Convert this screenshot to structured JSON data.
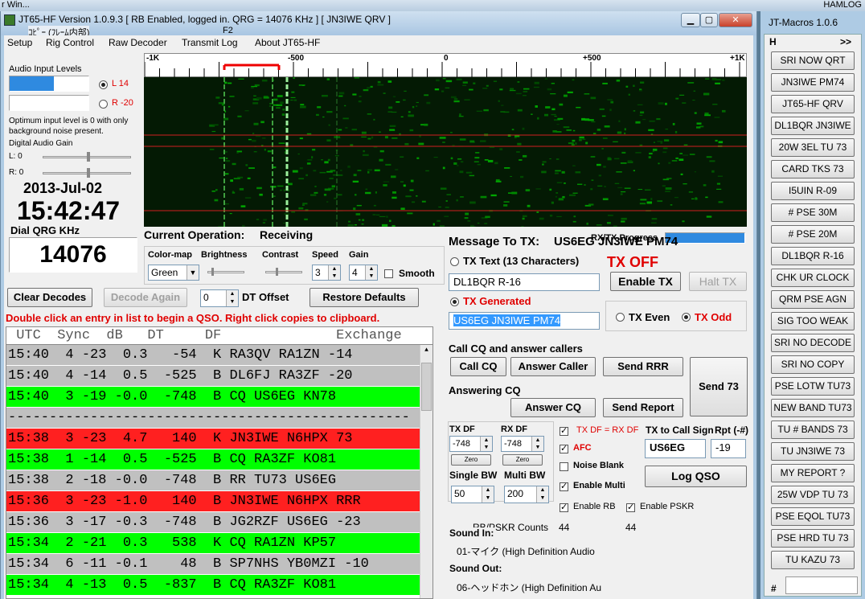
{
  "desktop": {
    "left_text": "r Win...",
    "right_text": "HAMLOG"
  },
  "title": {
    "text": "JT65-HF Version 1.0.9.3  [ RB Enabled, logged in.  QRG = 14076 KHz ] [ JN3IWE QRV ]",
    "overlay": "ｺﾋﾟｰ (ﾌﾚｰﾑ内部)",
    "overlay_key": "F2"
  },
  "menu": [
    "Setup",
    "Rig Control",
    "Raw Decoder",
    "Transmit Log",
    "About JT65-HF"
  ],
  "audio": {
    "label": "Audio Input Levels",
    "left": "L 14",
    "right": "R -20",
    "note": "Optimum input level is 0 with only background noise present.",
    "gain_label": "Digital Audio Gain",
    "gain_l": "L: 0",
    "gain_r": "R: 0",
    "left_level": 0.56
  },
  "clock": {
    "date": "2013-Jul-02",
    "time": "15:42:47",
    "qrg_label": "Dial QRG KHz",
    "qrg": "14076"
  },
  "waterfall": {
    "ticks": [
      "-1K",
      "-500",
      "0",
      "+500",
      "+1K"
    ]
  },
  "operation": {
    "label": "Current Operation:",
    "value": "Receiving"
  },
  "progress": {
    "label": "RX/TX Progress"
  },
  "controls": {
    "colormap_label": "Color-map",
    "colormap": "Green",
    "brightness_label": "Brightness",
    "contrast_label": "Contrast",
    "speed_label": "Speed",
    "speed": "3",
    "gain_label": "Gain",
    "gain": "4",
    "smooth": "Smooth"
  },
  "buttons": {
    "clear": "Clear Decodes",
    "decode_again": "Decode Again",
    "dt_offset": "0",
    "dt_label": "DT Offset",
    "restore": "Restore Defaults"
  },
  "hint": "Double click an entry in list to begin a QSO.  Right click copies to clipboard.",
  "decodes": {
    "header": " UTC  Sync  dB   DT     DF              Exchange",
    "rows": [
      {
        "t": "15:40  4 -23  0.3   -54  K RA3QV RA1ZN -14",
        "c": "#c0c0c0"
      },
      {
        "t": "15:40  4 -14  0.5  -525  B DL6FJ RA3ZF -20",
        "c": "#c0c0c0"
      },
      {
        "t": "15:40  3 -19 -0.0  -748  B CQ US6EG KN78",
        "c": "#00ff00"
      },
      {
        "t": "-------------------------------------------------",
        "c": "#c0c0c0"
      },
      {
        "t": "15:38  3 -23  4.7   140  K JN3IWE N6HPX 73",
        "c": "#ff2020"
      },
      {
        "t": "15:38  1 -14  0.5  -525  B CQ RA3ZF KO81",
        "c": "#00ff00"
      },
      {
        "t": "15:38  2 -18 -0.0  -748  B RR TU73 US6EG",
        "c": "#c0c0c0"
      },
      {
        "t": "15:36  3 -23 -1.0   140  B JN3IWE N6HPX RRR",
        "c": "#ff2020"
      },
      {
        "t": "15:36  3 -17 -0.3  -748  B JG2RZF US6EG -23",
        "c": "#c0c0c0"
      },
      {
        "t": "15:34  2 -21  0.3   538  K CQ RA1ZN KP57",
        "c": "#00ff00"
      },
      {
        "t": "15:34  6 -11 -0.1    48  B SP7NHS YB0MZI -10",
        "c": "#c0c0c0"
      },
      {
        "t": "15:34  4 -13  0.5  -837  B CQ RA3ZF KO81",
        "c": "#00ff00"
      }
    ]
  },
  "tx": {
    "msg_label": "Message To TX:",
    "msg": "US6EG JN3IWE PM74",
    "text_label": "TX Text (13 Characters)",
    "tx_state": "TX OFF",
    "text_value": "DL1BQR R-16",
    "enable": "Enable TX",
    "halt": "Halt TX",
    "gen_label": "TX Generated",
    "gen_value": "US6EG JN3IWE PM74",
    "even": "TX Even",
    "odd": "TX Odd"
  },
  "cq": {
    "label": "Call CQ and answer callers",
    "call": "Call CQ",
    "answer_caller": "Answer Caller",
    "rrr": "Send RRR",
    "send73": "Send 73",
    "answering": "Answering CQ",
    "answer_cq": "Answer CQ",
    "report": "Send Report"
  },
  "df": {
    "tx_label": "TX DF",
    "tx": "-748",
    "rx_label": "RX DF",
    "rx": "-748",
    "zero": "Zero",
    "eq": "TX DF = RX DF",
    "afc": "AFC",
    "nb": "Noise Blank",
    "multi": "Enable Multi",
    "rb": "Enable RB",
    "pskr": "Enable PSKR",
    "single_label": "Single BW",
    "single": "50",
    "multi_label": "Multi BW",
    "multi_val": "200"
  },
  "call": {
    "label": "TX to Call Sign",
    "value": "US6EG",
    "rpt_label": "Rpt (-#)",
    "rpt": "-19",
    "log": "Log QSO"
  },
  "counts": {
    "label": "RB/PSKR Counts",
    "rb": "44",
    "pskr": "44"
  },
  "sound": {
    "in_label": "Sound In:",
    "in": "01-マイク (High Definition Audio",
    "out_label": "Sound Out:",
    "out": "06-ヘッドホン (High Definition Au"
  },
  "macros": {
    "title": "JT-Macros 1.0.6",
    "h": "H",
    "arrows": ">>",
    "items": [
      "SRI NOW QRT",
      "JN3IWE PM74",
      "JT65-HF QRV",
      "DL1BQR JN3IWE",
      "20W 3EL TU 73",
      "CARD TKS 73",
      "I5UIN R-09",
      "# PSE 30M",
      "# PSE 20M",
      "DL1BQR R-16",
      "CHK UR CLOCK",
      "QRM PSE AGN",
      "SIG TOO WEAK",
      "SRI NO DECODE",
      "SRI NO COPY",
      "PSE LOTW TU73",
      "NEW BAND TU73",
      "TU # BANDS 73",
      "TU JN3IWE 73",
      "MY REPORT ?",
      "25W VDP TU 73",
      "PSE EQOL TU73",
      "PSE HRD TU 73",
      "TU KAZU 73"
    ],
    "hash": "#"
  }
}
